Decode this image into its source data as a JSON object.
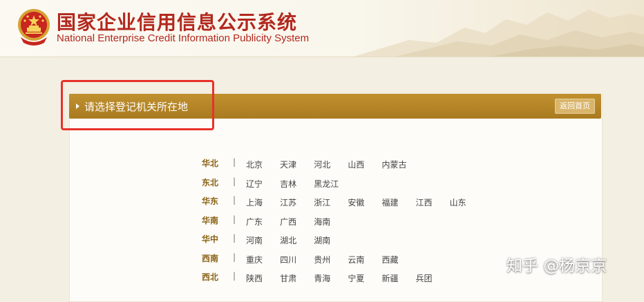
{
  "header": {
    "title_cn": "国家企业信用信息公示系统",
    "title_en": "National Enterprise Credit Information Publicity System"
  },
  "section": {
    "title": "请选择登记机关所在地",
    "home_button": "返回首页"
  },
  "regions": [
    {
      "name": "华北",
      "provinces": [
        "北京",
        "天津",
        "河北",
        "山西",
        "内蒙古"
      ]
    },
    {
      "name": "东北",
      "provinces": [
        "辽宁",
        "吉林",
        "黑龙江"
      ]
    },
    {
      "name": "华东",
      "provinces": [
        "上海",
        "江苏",
        "浙江",
        "安徽",
        "福建",
        "江西",
        "山东"
      ]
    },
    {
      "name": "华南",
      "provinces": [
        "广东",
        "广西",
        "海南"
      ]
    },
    {
      "name": "华中",
      "provinces": [
        "河南",
        "湖北",
        "湖南"
      ]
    },
    {
      "name": "西南",
      "provinces": [
        "重庆",
        "四川",
        "贵州",
        "云南",
        "西藏"
      ]
    },
    {
      "name": "西北",
      "provinces": [
        "陕西",
        "甘肃",
        "青海",
        "宁夏",
        "新疆",
        "兵团"
      ]
    }
  ],
  "separator": "|",
  "watermark": "知乎 @杨京京",
  "colors": {
    "brand_red": "#b2281e",
    "bar_gold": "#b3831f",
    "highlight_red": "#e8312a"
  }
}
